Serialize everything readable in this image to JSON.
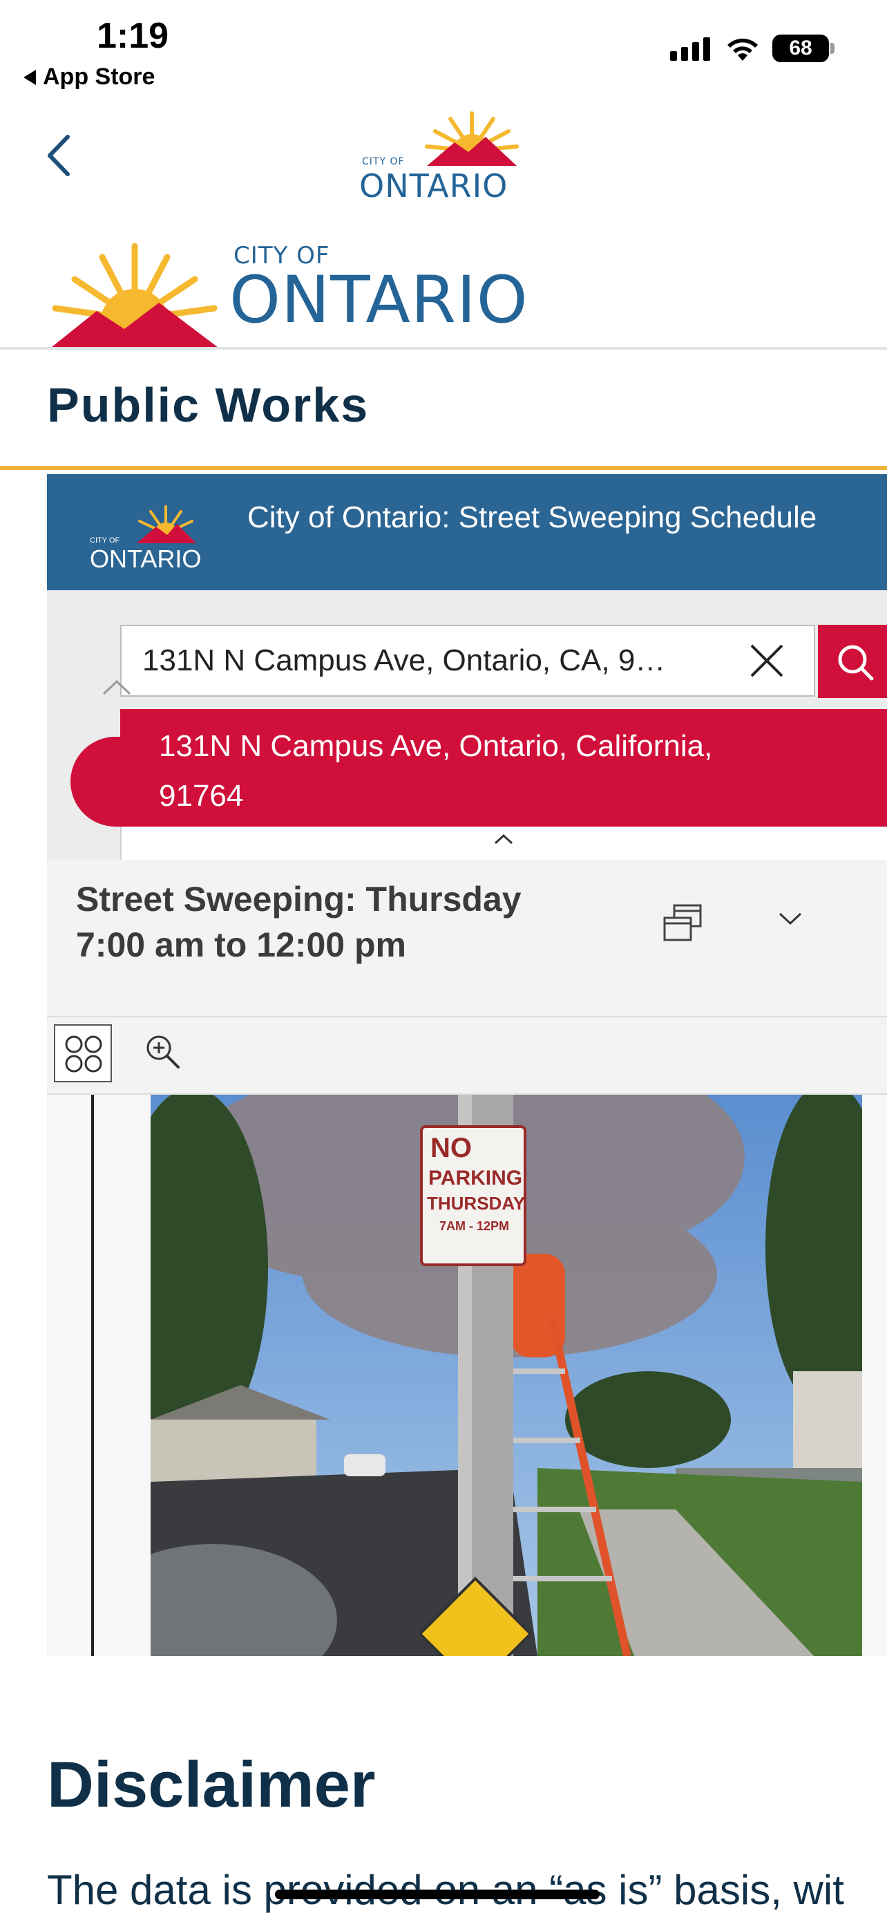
{
  "status_bar": {
    "time": "1:19",
    "back_app": "App Store",
    "battery": "68"
  },
  "header": {
    "logo_small": {
      "line1": "CITY OF",
      "line2": "ONTARIO"
    },
    "logo_large": {
      "line1": "CITY OF",
      "line2": "ONTARIO"
    },
    "page_title": "Public Works"
  },
  "app": {
    "banner_logo": {
      "line1": "CITY OF",
      "line2": "ONTARIO"
    },
    "banner_title": "City of Ontario: Street Sweeping Schedule",
    "search": {
      "value": "131N N Campus Ave, Ontario, CA, 9…"
    },
    "suggestion": {
      "line1": "131N N Campus Ave, Ontario, California,",
      "line2": "91764"
    },
    "info": {
      "line1": "Street Sweeping: Thursday",
      "line2": "7:00 am to 12:00 pm"
    },
    "photo_sign": {
      "line1": "NO",
      "line2": "PARKING",
      "line3": "THURSDAY",
      "line4": "7AM - 12PM"
    }
  },
  "disclaimer": {
    "title": "Disclaimer",
    "text": "The data is provided on an “as is” basis, wit"
  },
  "colors": {
    "brand_blue": "#2b6593",
    "accent_red": "#d0103a",
    "gold": "#f0b43c",
    "navy": "#0f3048"
  },
  "icons": [
    "back-chevron-icon",
    "close-icon",
    "search-icon",
    "list-icon",
    "chevron-up-icon",
    "dock-icon",
    "chevron-down-icon",
    "grid-icon",
    "zoom-in-icon"
  ]
}
